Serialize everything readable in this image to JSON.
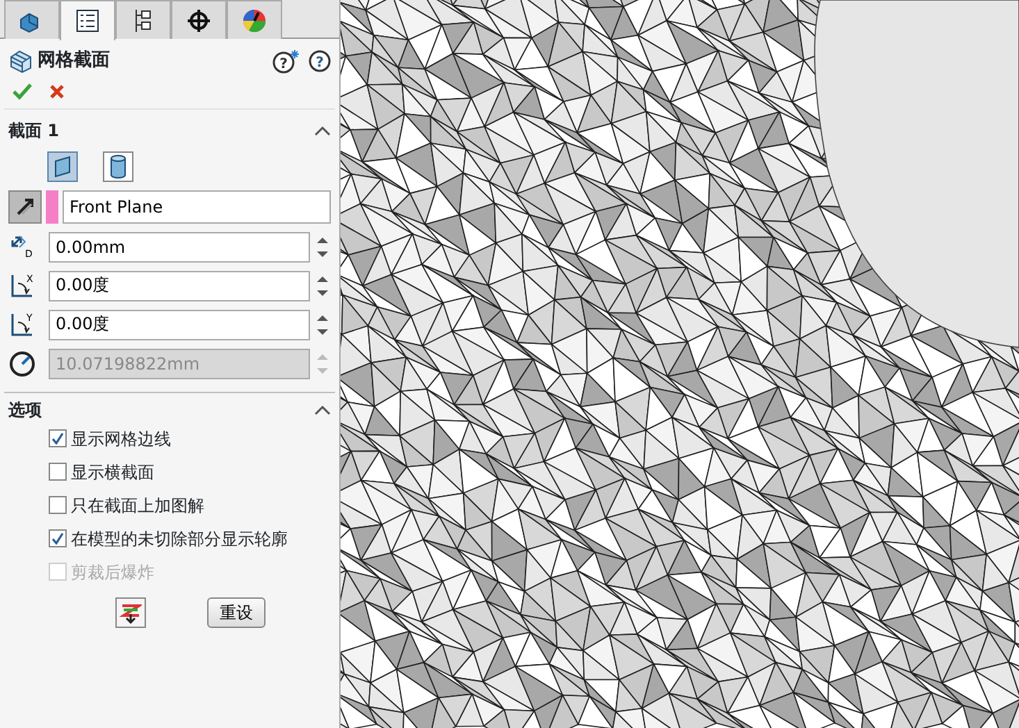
{
  "tabs": [
    {
      "kind": "part",
      "selected": false
    },
    {
      "kind": "property",
      "selected": true
    },
    {
      "kind": "config",
      "selected": false
    },
    {
      "kind": "dimxpert",
      "selected": false
    },
    {
      "kind": "display",
      "selected": false
    }
  ],
  "panel": {
    "title": "网格截面",
    "help_marks": [
      "?",
      "?"
    ]
  },
  "section": {
    "title": "截面 1",
    "expanded": true,
    "shapes": [
      {
        "kind": "plane",
        "selected": true
      },
      {
        "kind": "cylinder",
        "selected": false
      }
    ],
    "reference": {
      "value": "Front Plane",
      "color": "#f47fc6"
    },
    "fields": [
      {
        "kind": "distance",
        "icon_text": "D",
        "value": "0.00mm",
        "disabled": false
      },
      {
        "kind": "angle",
        "icon_text": "X",
        "value": "0.00度",
        "disabled": false
      },
      {
        "kind": "angle",
        "icon_text": "Y",
        "value": "0.00度",
        "disabled": false
      },
      {
        "kind": "radius",
        "value": "10.07198822mm",
        "disabled": true
      }
    ]
  },
  "options": {
    "title": "选项",
    "expanded": true,
    "checkboxes": [
      {
        "label": "显示网格边线",
        "checked": true,
        "disabled": false
      },
      {
        "label": "显示横截面",
        "checked": false,
        "disabled": false
      },
      {
        "label": "只在截面上加图解",
        "checked": false,
        "disabled": false
      },
      {
        "label": "在模型的未切除部分显示轮廓",
        "checked": true,
        "disabled": false
      },
      {
        "label": "剪裁后爆炸",
        "checked": false,
        "disabled": true
      }
    ],
    "reset_button": "重设"
  }
}
